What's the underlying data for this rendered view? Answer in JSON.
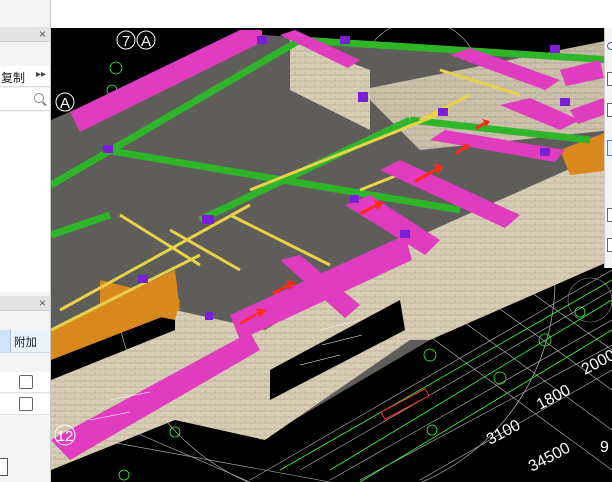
{
  "left_panel": {
    "close_glyph": "×",
    "copy_label": "复制",
    "more_glyph": "▸▸",
    "attr_header_label": "附加",
    "lower_close_glyph": "×",
    "rows": [
      {
        "checked": false
      },
      {
        "checked": false
      }
    ]
  },
  "viewport": {
    "axis_labels": [
      "7",
      "A",
      "A",
      "12"
    ],
    "dimensions": [
      "3100",
      "1800",
      "2000",
      "34500",
      "9"
    ]
  },
  "colors": {
    "beam_magenta": "#e03cc0",
    "beam_green": "#2fb52a",
    "beam_yellow": "#e8d24a",
    "slab_gray": "#5e5d5a",
    "wall_brick": "#d8cdb5",
    "orange_fill": "#d9881e",
    "arrow_red": "#ff2a1a",
    "background": "#000000"
  }
}
